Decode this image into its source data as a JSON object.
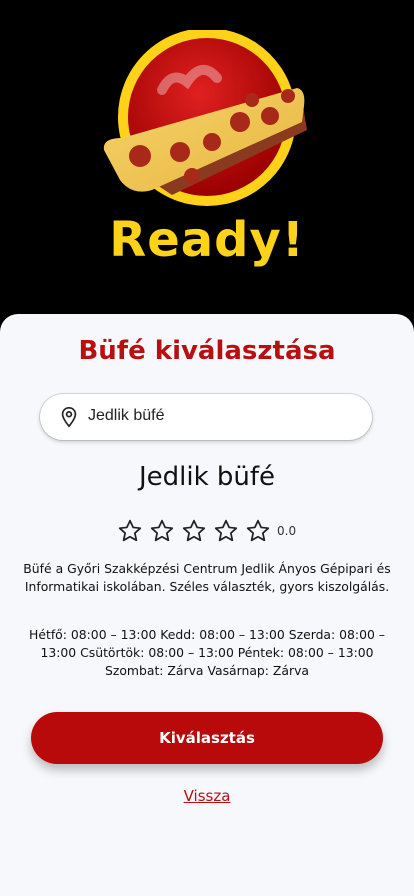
{
  "hero": {
    "ready_text": "Ready!",
    "logo_icon": "pizza-slice-logo"
  },
  "sheet": {
    "title": "Büfé kiválasztása",
    "search": {
      "value": "Jedlik büfé",
      "icon": "location-pin-icon"
    },
    "shop": {
      "name": "Jedlik büfé",
      "rating_value": "0.0",
      "stars_total": 5,
      "stars_filled": 0,
      "description": "Büfé a Győri Szakképzési Centrum Jedlik Ányos Gépipari és Informatikai iskolában. Széles választék, gyors kiszolgálás.",
      "hours": "Hétfő: 08:00 – 13:00 Kedd: 08:00 – 13:00 Szerda: 08:00 – 13:00 Csütörtök: 08:00 – 13:00 Péntek: 08:00 – 13:00 Szombat: Zárva Vasárnap: Zárva"
    },
    "select_button": "Kiválasztás",
    "back_link": "Vissza"
  },
  "colors": {
    "accent_red": "#B81010",
    "button_red": "#B80A0A",
    "logo_yellow": "#FFD21A",
    "sheet_bg": "#F6F8FB"
  }
}
